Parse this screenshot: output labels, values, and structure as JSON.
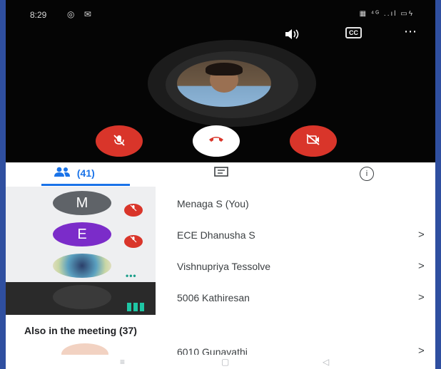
{
  "status_bar": {
    "time": "8:29",
    "left_icons": "◎ ✉",
    "right_icons": "▦ ⁴ᴳ ..ıl ▭ϟ"
  },
  "call": {
    "speaker_icon": "speaker-icon",
    "captions_label": "CC",
    "more_icon": "⋯",
    "controls": {
      "mic_icon": "mic-off",
      "end_icon": "☎",
      "camera_icon": "camera-off"
    }
  },
  "tabs": {
    "people_count": "(41)",
    "chat_icon": "chat-icon",
    "info_icon": "i"
  },
  "participants": [
    {
      "initial": "M",
      "name": "Menaga S (You)",
      "color": "#5f6368",
      "status": "muted",
      "chevron": ""
    },
    {
      "initial": "E",
      "name": "ECE Dhanusha S",
      "color": "#7b2cc9",
      "status": "muted",
      "chevron": ">"
    },
    {
      "initial": "",
      "name": "Vishnupriya Tessolve",
      "color": "#8fb5c9",
      "status": "dots",
      "chevron": ">"
    },
    {
      "initial": "",
      "name": "5006 Kathiresan",
      "color": "#2a2a2a",
      "status": "speaking",
      "chevron": ">"
    }
  ],
  "section_title": "Also in the meeting (37)",
  "partial_row": {
    "name": "6010 Gunavathi",
    "chevron": ">"
  },
  "nav": {
    "menu": "≡",
    "home": "▢",
    "back": "◁"
  }
}
